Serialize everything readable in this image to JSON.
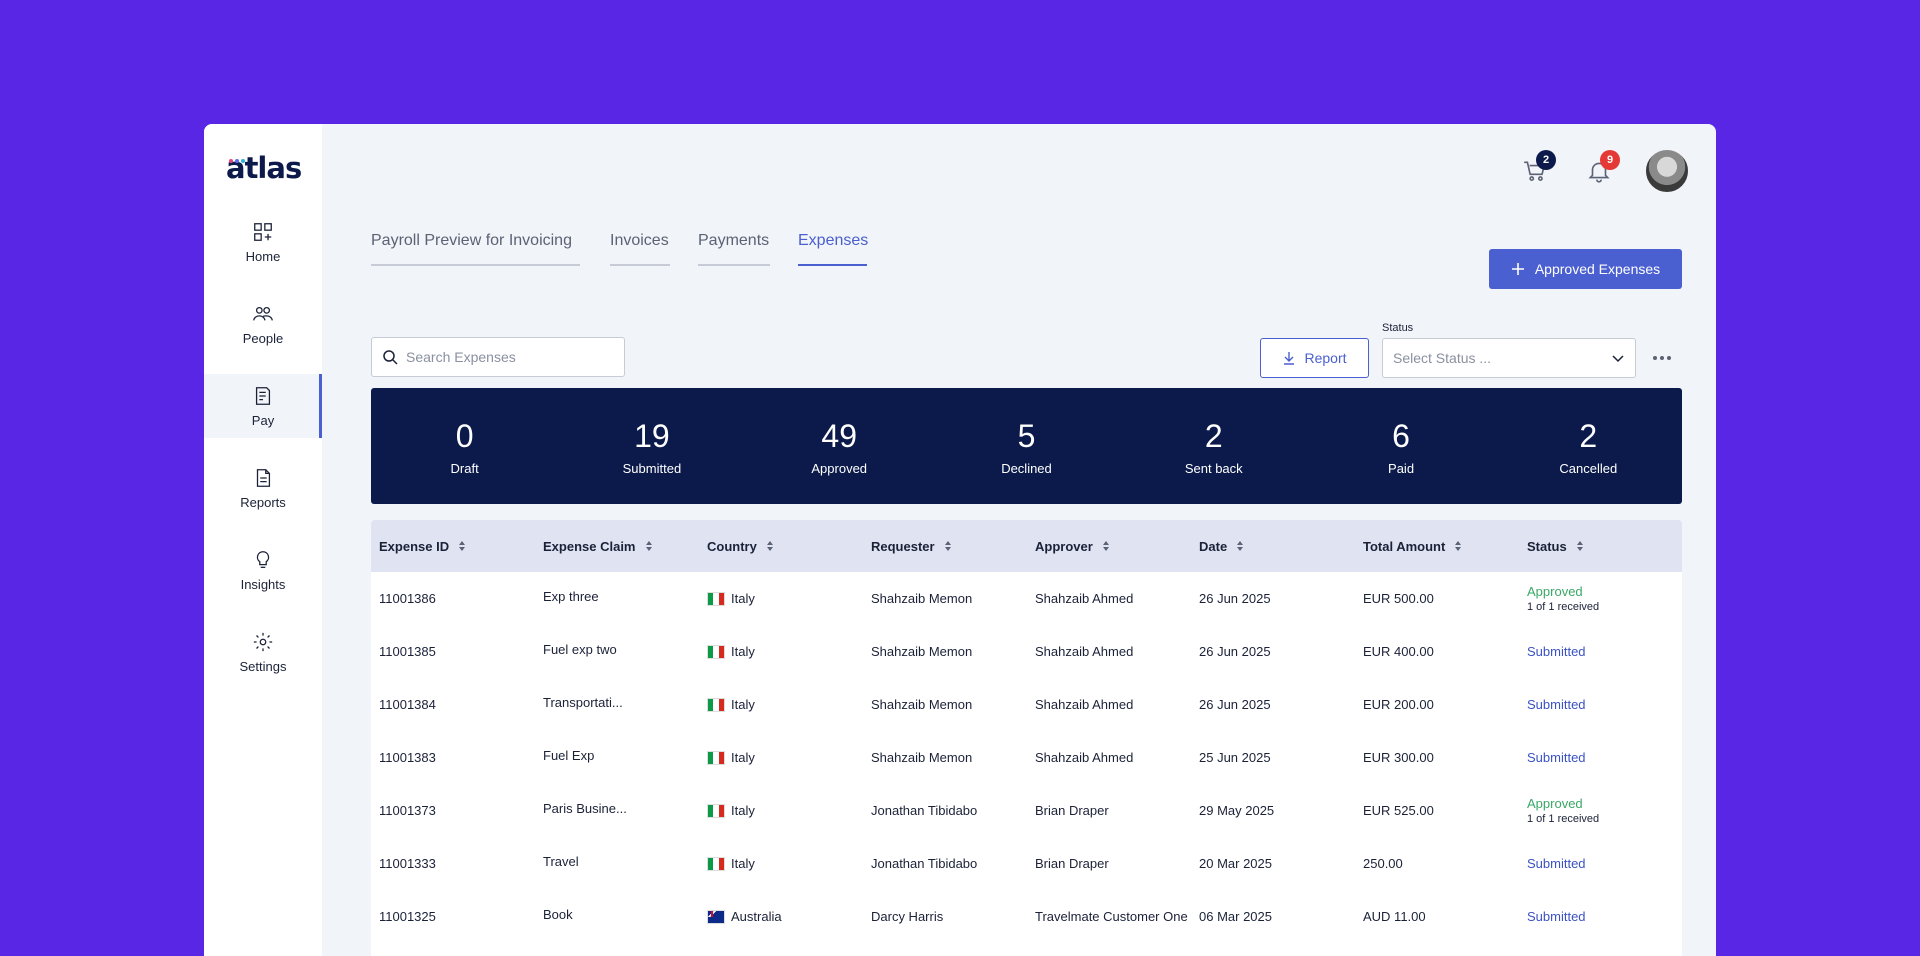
{
  "brand": {
    "name": "atlas",
    "dot_colors": [
      "#e6457a",
      "#5b6cf0",
      "#2bb3d8"
    ]
  },
  "sidebar": {
    "items": [
      {
        "label": "Home",
        "icon": "grid-icon",
        "active": false
      },
      {
        "label": "People",
        "icon": "people-icon",
        "active": false
      },
      {
        "label": "Pay",
        "icon": "invoice-icon",
        "active": true
      },
      {
        "label": "Reports",
        "icon": "document-icon",
        "active": false
      },
      {
        "label": "Insights",
        "icon": "lightbulb-icon",
        "active": false
      },
      {
        "label": "Settings",
        "icon": "gear-icon",
        "active": false
      }
    ]
  },
  "header": {
    "cart_count": "2",
    "notification_count": "9"
  },
  "tabs": [
    {
      "label": "Payroll Preview for Invoicing",
      "active": false
    },
    {
      "label": "Invoices",
      "active": false
    },
    {
      "label": "Payments",
      "active": false
    },
    {
      "label": "Expenses",
      "active": true
    }
  ],
  "actions": {
    "primary_label": "Approved Expenses",
    "report_label": "Report"
  },
  "search": {
    "placeholder": "Search Expenses"
  },
  "status_filter": {
    "label": "Status",
    "placeholder": "Select Status ..."
  },
  "stats": [
    {
      "value": "0",
      "label": "Draft"
    },
    {
      "value": "19",
      "label": "Submitted"
    },
    {
      "value": "49",
      "label": "Approved"
    },
    {
      "value": "5",
      "label": "Declined"
    },
    {
      "value": "2",
      "label": "Sent back"
    },
    {
      "value": "6",
      "label": "Paid"
    },
    {
      "value": "2",
      "label": "Cancelled"
    }
  ],
  "table": {
    "columns": [
      "Expense ID",
      "Expense Claim",
      "Country",
      "Requester",
      "Approver",
      "Date",
      "Total Amount",
      "Status"
    ],
    "rows": [
      {
        "id": "11001386",
        "claim": "Exp three",
        "country": "Italy",
        "flag": "italy",
        "requester": "Shahzaib Memon",
        "approver": "Shahzaib Ahmed",
        "date": "26 Jun 2025",
        "amount": "EUR 500.00",
        "status": "Approved",
        "status_sub": "1 of 1 received",
        "status_type": "approved"
      },
      {
        "id": "11001385",
        "claim": "Fuel exp two",
        "country": "Italy",
        "flag": "italy",
        "requester": "Shahzaib Memon",
        "approver": "Shahzaib Ahmed",
        "date": "26 Jun 2025",
        "amount": "EUR 400.00",
        "status": "Submitted",
        "status_sub": "",
        "status_type": "submitted"
      },
      {
        "id": "11001384",
        "claim": "Transportati...",
        "country": "Italy",
        "flag": "italy",
        "requester": "Shahzaib Memon",
        "approver": "Shahzaib Ahmed",
        "date": "26 Jun 2025",
        "amount": "EUR 200.00",
        "status": "Submitted",
        "status_sub": "",
        "status_type": "submitted"
      },
      {
        "id": "11001383",
        "claim": "Fuel Exp",
        "country": "Italy",
        "flag": "italy",
        "requester": "Shahzaib Memon",
        "approver": "Shahzaib Ahmed",
        "date": "25 Jun 2025",
        "amount": "EUR 300.00",
        "status": "Submitted",
        "status_sub": "",
        "status_type": "submitted"
      },
      {
        "id": "11001373",
        "claim": "Paris Busine...",
        "country": "Italy",
        "flag": "italy",
        "requester": "Jonathan Tibidabo",
        "approver": "Brian Draper",
        "date": "29 May 2025",
        "amount": "EUR 525.00",
        "status": "Approved",
        "status_sub": "1 of 1 received",
        "status_type": "approved"
      },
      {
        "id": "11001333",
        "claim": "Travel",
        "country": "Italy",
        "flag": "italy",
        "requester": "Jonathan Tibidabo",
        "approver": "Brian Draper",
        "date": "20 Mar 2025",
        "amount": "250.00",
        "status": "Submitted",
        "status_sub": "",
        "status_type": "submitted"
      },
      {
        "id": "11001325",
        "claim": "Book",
        "country": "Australia",
        "flag": "australia",
        "requester": "Darcy Harris",
        "approver": "Travelmate Customer One",
        "date": "06 Mar 2025",
        "amount": "AUD 11.00",
        "status": "Submitted",
        "status_sub": "",
        "status_type": "submitted"
      }
    ]
  },
  "colors": {
    "background": "#5926e6",
    "accent": "#4a5fd0",
    "stats_bg": "#0b1a4a",
    "approved": "#3aa866",
    "submitted": "#3b52c4",
    "cart_badge": "#0b1a4a",
    "notification_badge": "#e53935"
  }
}
